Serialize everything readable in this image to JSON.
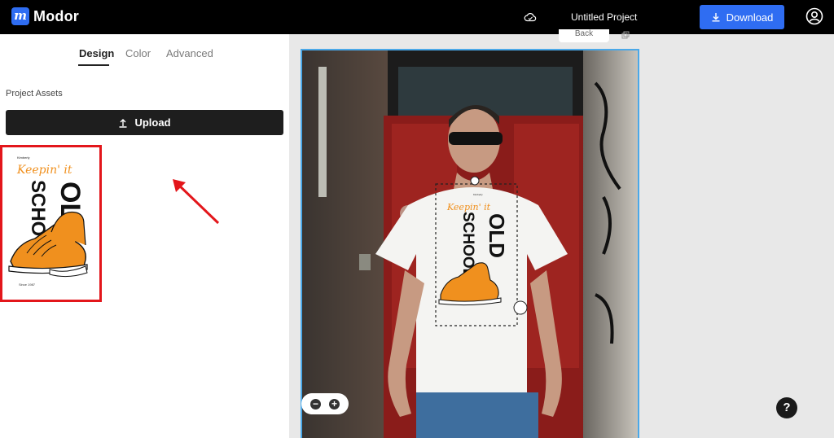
{
  "app": {
    "name": "Modor",
    "logo_letter": "m"
  },
  "header": {
    "project_title": "Untitled Project",
    "download_label": "Download"
  },
  "tabs": [
    {
      "label": "Design",
      "active": true
    },
    {
      "label": "Color",
      "active": false
    },
    {
      "label": "Advanced",
      "active": false
    }
  ],
  "assets": {
    "section_label": "Project Assets",
    "upload_label": "Upload"
  },
  "design": {
    "small_text": "Kimberly",
    "script_text": "Keepin' it",
    "big_text_1": "OLD",
    "big_text_2": "SCHOOL",
    "footer_text": "Since 1987"
  },
  "canvas": {
    "back_label": "Back"
  },
  "help": {
    "label": "?"
  },
  "colors": {
    "accent": "#2f6df2",
    "highlight": "#e3161b",
    "selection": "#4aa8e8",
    "shoe_orange": "#f0901e"
  }
}
